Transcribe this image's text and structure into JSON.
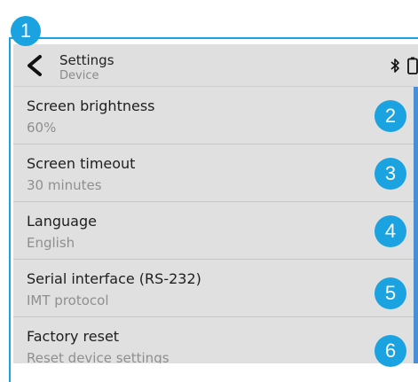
{
  "callouts": [
    "1",
    "2",
    "3",
    "4",
    "5",
    "6"
  ],
  "header": {
    "title": "Settings",
    "subtitle": "Device"
  },
  "icons": {
    "back": "chevron-left-icon",
    "bluetooth": "bluetooth-icon",
    "battery": "battery-icon"
  },
  "settings": [
    {
      "title": "Screen brightness",
      "value": "60%"
    },
    {
      "title": "Screen timeout",
      "value": "30 minutes"
    },
    {
      "title": "Language",
      "value": "English"
    },
    {
      "title": "Serial interface (RS-232)",
      "value": "IMT protocol"
    },
    {
      "title": "Factory reset",
      "value": "Reset device settings"
    }
  ],
  "colors": {
    "callout": "#1aa3e0",
    "screen_bg": "#e0e0e0",
    "scrollbar": "#4a8fd4"
  }
}
